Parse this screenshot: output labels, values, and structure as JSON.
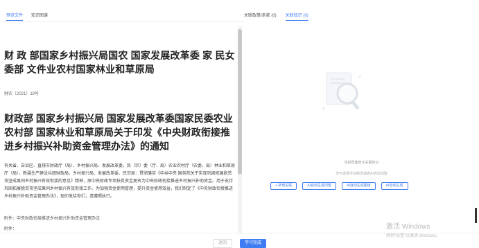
{
  "left_tabs": [
    "预览文件",
    "知识图谱"
  ],
  "right_tabs": [
    "关联政策/条款 (0)",
    "关联知识 (0)"
  ],
  "doc": {
    "title1": "财 政 部国家乡村振兴局国农 国家发展改革委 家 民女委部 文件业农村国家林业和草原局",
    "doc_no": "财农〔2021〕19号",
    "title2": "财政部 国家乡村振兴局 国家发展改革委国家民委农业农村部 国家林业和草原局关于印发《中央财政衔接推进乡村振兴补助资金管理办法》的通知",
    "para": "有关省、自治区、直辖市财政厅（局）、乡村振兴局、发展改革委、民（宗）委（厅、局）农业农村厅（农委、局）林业和草原厅（局），新疆生产建设兵团财政局、乡村振兴局、发展改革委、民宗局：贯彻落实《中共中央 国务院关于实现巩固拓展脱贫攻坚成果同乡村振兴有效衔接的意见》精神，原中央财政专项扶贫资金更名为中央财政衔接推进乡村振兴补助资金。用于支持巩固拓展脱贫攻坚成果同乡村振兴有效衔接工作。为加强资金使用管理，提升资金使用效益，我们制定了《中央财政衔接推进乡村振兴补助资金管理办法》，现印发给你们，请遵照执行。",
    "attach": "附件：中央财政衔接推进乡村振兴补助资金管理办法",
    "attach2": "附件："
  },
  "empty": {
    "title": "当前政策暂无关联知识",
    "hint": "您可选择手动新增或者AI自动创建"
  },
  "actions": [
    "+ 新增关联",
    "AI自动生成问题",
    "AI自动生成图谱",
    "AI自动生成"
  ],
  "footer": {
    "return": "返回",
    "learn": "学习完成"
  },
  "watermark": {
    "line1": "激活 Windows",
    "line2": "转到“设置”以激活 Windows。"
  },
  "colors": {
    "accent": "#3f7df3"
  }
}
